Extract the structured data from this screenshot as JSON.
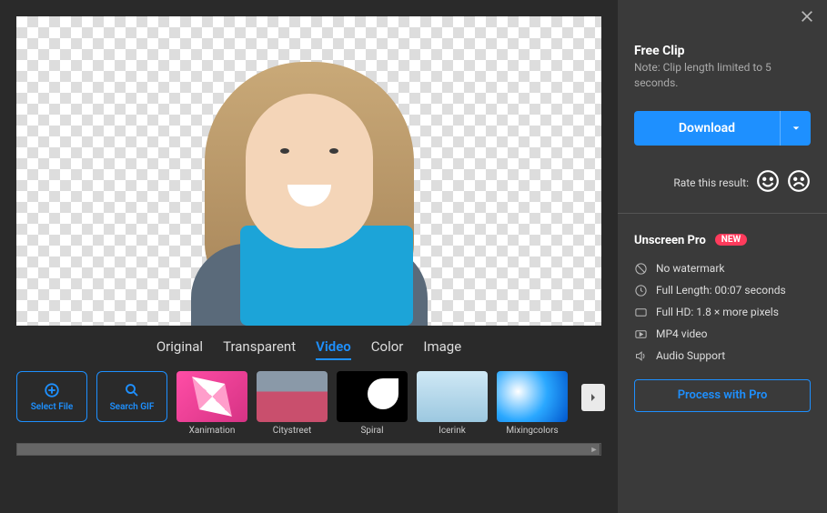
{
  "sidebar_right": {
    "close_icon": "close-icon",
    "free": {
      "title": "Free Clip",
      "note": "Note: Clip length limited to 5 seconds."
    },
    "download": {
      "label": "Download"
    },
    "rate": {
      "label": "Rate this result:"
    },
    "pro": {
      "title": "Unscreen Pro",
      "badge": "NEW",
      "features": [
        {
          "icon": "no-watermark-icon",
          "text": "No watermark"
        },
        {
          "icon": "duration-icon",
          "text": "Full Length: 00:07 seconds"
        },
        {
          "icon": "hd-icon",
          "text": "Full HD: 1.8 × more pixels"
        },
        {
          "icon": "play-icon",
          "text": "MP4 video"
        },
        {
          "icon": "audio-icon",
          "text": "Audio Support"
        }
      ],
      "button": "Process with Pro"
    }
  },
  "tabs": [
    "Original",
    "Transparent",
    "Video",
    "Color",
    "Image"
  ],
  "active_tab": "Video",
  "upload_buttons": [
    {
      "icon": "add-icon",
      "label": "Select File"
    },
    {
      "icon": "search-icon",
      "label": "Search GIF"
    }
  ],
  "thumbs": [
    {
      "label": "Xanimation"
    },
    {
      "label": "Citystreet"
    },
    {
      "label": "Spiral"
    },
    {
      "label": "Icerink"
    },
    {
      "label": "Mixingcolors"
    }
  ]
}
